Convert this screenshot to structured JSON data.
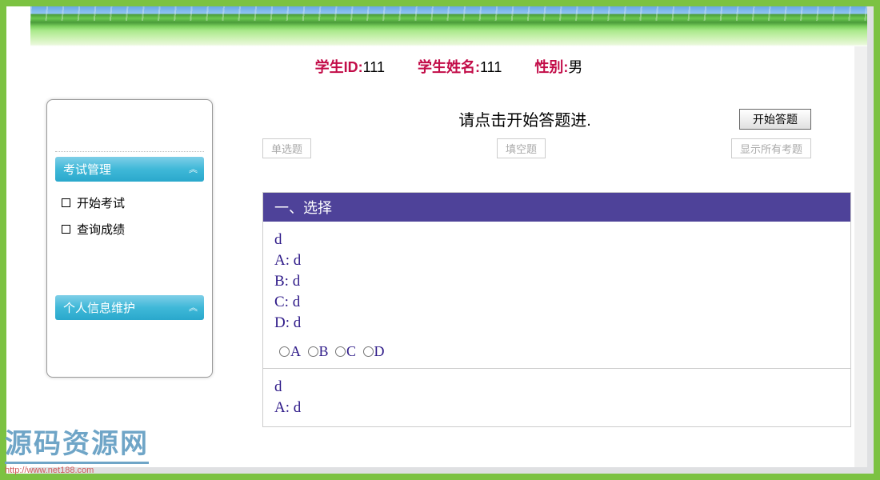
{
  "student": {
    "id_label": "学生ID:",
    "id_value": "111",
    "name_label": "学生姓名:",
    "name_value": "111",
    "gender_label": "性别:",
    "gender_value": "男"
  },
  "sidebar": {
    "section1": {
      "title": "考试管理",
      "items": [
        "开始考试",
        "查询成绩"
      ]
    },
    "section2": {
      "title": "个人信息维护",
      "items": []
    }
  },
  "exam": {
    "instruction": "请点击开始答题进.",
    "start_button": "开始答题",
    "tabs": {
      "single": "单选题",
      "fill": "填空题",
      "showall": "显示所有考题"
    }
  },
  "question_panel": {
    "heading": "一、选择",
    "q1": {
      "stem": "d",
      "A": "A: d",
      "B": "B: d",
      "C": "C: d",
      "D": "D: d",
      "optA": "A",
      "optB": "B",
      "optC": "C",
      "optD": "D"
    },
    "q2": {
      "stem": "d",
      "A": "A: d"
    }
  },
  "watermark": {
    "main": "源码资源网",
    "sub": "http://www.net188.com"
  }
}
